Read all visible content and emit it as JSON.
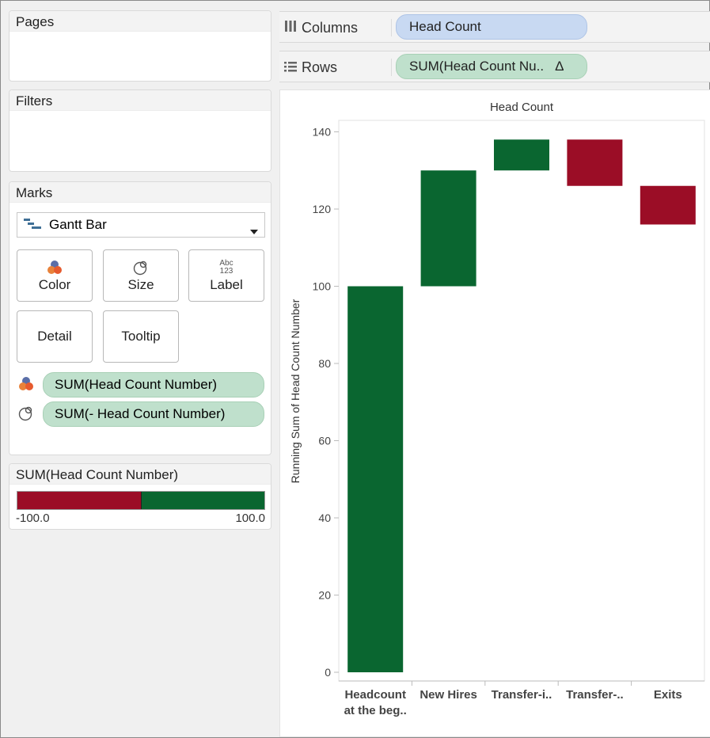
{
  "pages": {
    "title": "Pages"
  },
  "filters": {
    "title": "Filters"
  },
  "marks": {
    "title": "Marks",
    "mark_type": "Gantt Bar",
    "buttons": {
      "color": "Color",
      "size": "Size",
      "label": "Label",
      "label_icon_top": "Abc",
      "label_icon_bottom": "123",
      "detail": "Detail",
      "tooltip": "Tooltip"
    },
    "fields": [
      {
        "icon": "color-icon",
        "label": "SUM(Head Count Number)"
      },
      {
        "icon": "size-icon",
        "label": "SUM(- Head Count Number)"
      }
    ]
  },
  "legend": {
    "title": "SUM(Head Count Number)",
    "min_label": "-100.0",
    "max_label": "100.0",
    "colors": {
      "negative": "#9b0d26",
      "positive": "#0a6630"
    }
  },
  "shelves": {
    "columns": {
      "label": "Columns",
      "pill": "Head Count"
    },
    "rows": {
      "label": "Rows",
      "pill": "SUM(Head Count Nu..",
      "pill_icon": "Δ"
    }
  },
  "chart_data": {
    "type": "bar",
    "subtype": "waterfall-gantt",
    "title": "Head Count",
    "xlabel": "",
    "ylabel": "Running Sum of Head Count Number",
    "ylim": [
      0,
      145
    ],
    "yticks": [
      0,
      20,
      40,
      60,
      80,
      100,
      120,
      140
    ],
    "categories": [
      "Headcount at the beg..",
      "New Hires",
      "Transfer-i..",
      "Transfer-..",
      "Exits"
    ],
    "category_lines": [
      [
        "Headcount",
        "at the beg.."
      ],
      [
        "New Hires"
      ],
      [
        "Transfer-i.."
      ],
      [
        "Transfer-.."
      ],
      [
        "Exits"
      ]
    ],
    "bars": [
      {
        "start": 0,
        "end": 100,
        "change": 100,
        "color": "#0a6630"
      },
      {
        "start": 100,
        "end": 130,
        "change": 30,
        "color": "#0a6630"
      },
      {
        "start": 130,
        "end": 138,
        "change": 8,
        "color": "#0a6630"
      },
      {
        "start": 138,
        "end": 126,
        "change": -12,
        "color": "#9b0d26"
      },
      {
        "start": 126,
        "end": 116,
        "change": -10,
        "color": "#9b0d26"
      }
    ],
    "grid": false
  }
}
